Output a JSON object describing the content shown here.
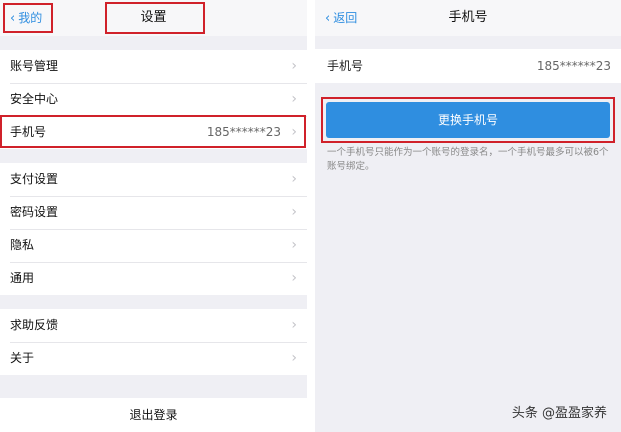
{
  "left": {
    "back_label": "我的",
    "title": "设置",
    "group1": [
      {
        "label": "账号管理",
        "value": ""
      },
      {
        "label": "安全中心",
        "value": ""
      },
      {
        "label": "手机号",
        "value": "185******23"
      }
    ],
    "group2": [
      {
        "label": "支付设置"
      },
      {
        "label": "密码设置"
      },
      {
        "label": "隐私"
      },
      {
        "label": "通用"
      }
    ],
    "group3": [
      {
        "label": "求助反馈"
      },
      {
        "label": "关于"
      }
    ],
    "logout_label": "退出登录"
  },
  "right": {
    "back_label": "返回",
    "title": "手机号",
    "phone_label": "手机号",
    "phone_value": "185******23",
    "change_button": "更换手机号",
    "note": "一个手机号只能作为一个账号的登录名，一个手机号最多可以被6个账号绑定。"
  },
  "watermark": "头条 @盈盈家养",
  "colors": {
    "accent": "#2f8ee0",
    "highlight": "#d0212a"
  }
}
